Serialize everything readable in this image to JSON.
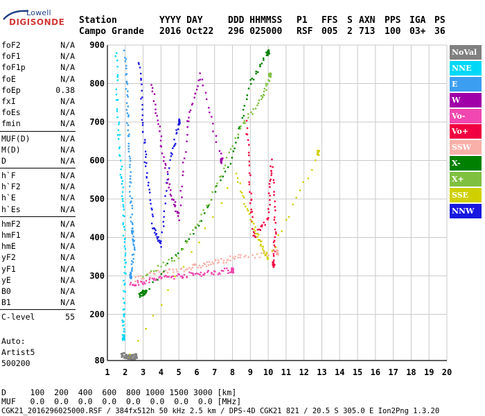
{
  "logo": {
    "top": "Lowell",
    "main": "DIGISONDE"
  },
  "header": {
    "labels": [
      "Station",
      "YYYY DAY",
      "DDD HHMMSS",
      "P1",
      "FFS",
      "S",
      "AXN",
      "PPS",
      "IGA",
      "PS"
    ],
    "values": [
      "Campo Grande",
      "2016 Oct22",
      "296 025000",
      "RSF",
      "005",
      "2",
      "713",
      "100",
      "03+",
      "36"
    ]
  },
  "params": [
    [
      {
        "label": "foF2",
        "value": "N/A"
      },
      {
        "label": "foF1",
        "value": "N/A"
      },
      {
        "label": "foF1p",
        "value": "N/A"
      },
      {
        "label": "foE",
        "value": "N/A"
      },
      {
        "label": "foEp",
        "value": "0.38"
      },
      {
        "label": "fxI",
        "value": "N/A"
      },
      {
        "label": "foEs",
        "value": "N/A"
      },
      {
        "label": "fmin",
        "value": "N/A"
      }
    ],
    [
      {
        "label": "MUF(D)",
        "value": "N/A"
      },
      {
        "label": "M(D)",
        "value": "N/A"
      },
      {
        "label": "D",
        "value": "N/A"
      }
    ],
    [
      {
        "label": "h`F",
        "value": "N/A"
      },
      {
        "label": "h`F2",
        "value": "N/A"
      },
      {
        "label": "h`E",
        "value": "N/A"
      },
      {
        "label": "h`Es",
        "value": "N/A"
      }
    ],
    [
      {
        "label": "hmF2",
        "value": "N/A"
      },
      {
        "label": "hmF1",
        "value": "N/A"
      },
      {
        "label": "hmE",
        "value": "N/A"
      },
      {
        "label": "yF2",
        "value": "N/A"
      },
      {
        "label": "yF1",
        "value": "N/A"
      },
      {
        "label": "yE",
        "value": "N/A"
      },
      {
        "label": "B0",
        "value": "N/A"
      },
      {
        "label": "B1",
        "value": "N/A"
      }
    ],
    [
      {
        "label": "C-level",
        "value": "55"
      }
    ]
  ],
  "auto": {
    "line1": "Auto:",
    "line2": "Artist5",
    "line3": "500200"
  },
  "legend": [
    {
      "label": "NoVal",
      "color": "#808080"
    },
    {
      "label": "NNE",
      "color": "#00d8f8"
    },
    {
      "label": "E",
      "color": "#3c9ef0"
    },
    {
      "label": "W",
      "color": "#a000a8"
    },
    {
      "label": "Vo-",
      "color": "#f048b0"
    },
    {
      "label": "Vo+",
      "color": "#f00040"
    },
    {
      "label": "SSW",
      "color": "#f8b0a8"
    },
    {
      "label": "X-",
      "color": "#008000"
    },
    {
      "label": "X+",
      "color": "#80c040"
    },
    {
      "label": "SSE",
      "color": "#d0d000"
    },
    {
      "label": "NNW",
      "color": "#1818e0"
    }
  ],
  "bottom": {
    "d_row": "D     100  200  400  600  800 1000 1500 3000 [km]",
    "muf_row": "MUF   0.0  0.0  0.0  0.0  0.0  0.0  0.0  0.0 [MHz]",
    "footer": "CGK21_2016296025000.RSF / 384fx512h 50 kHz 2.5 km / DPS-4D CGK21 821 / 20.5 S 305.0 E Ion2Png 1.3.20"
  },
  "chart_data": {
    "type": "scatter",
    "title": "",
    "xlabel": "",
    "ylabel": "",
    "xlim": [
      1,
      20
    ],
    "ylim": [
      80,
      900
    ],
    "x_ticks": [
      1,
      2,
      3,
      4,
      5,
      6,
      7,
      8,
      9,
      10,
      11,
      12,
      13,
      14,
      15,
      16,
      17,
      18,
      19,
      20
    ],
    "y_ticks": [
      80,
      200,
      300,
      400,
      500,
      600,
      700,
      800,
      900
    ],
    "grid": true,
    "legend_position": "right",
    "series": [
      {
        "name": "E",
        "color": "#3c9ef0",
        "points": [
          [
            2.0,
            880
          ],
          [
            2.1,
            760
          ],
          [
            2.2,
            640
          ],
          [
            2.3,
            520
          ],
          [
            2.4,
            420
          ],
          [
            2.5,
            380
          ],
          [
            2.3,
            300
          ]
        ]
      },
      {
        "name": "NNE",
        "color": "#00d8f8",
        "points": [
          [
            1.5,
            880
          ],
          [
            1.6,
            700
          ],
          [
            1.8,
            560
          ],
          [
            1.9,
            440
          ],
          [
            2.0,
            330
          ],
          [
            1.9,
            200
          ],
          [
            1.9,
            140
          ]
        ]
      },
      {
        "name": "NNW",
        "color": "#1818e0",
        "points": [
          [
            2.8,
            860
          ],
          [
            3.0,
            700
          ],
          [
            3.2,
            560
          ],
          [
            3.6,
            420
          ],
          [
            4.0,
            380
          ],
          [
            4.5,
            600
          ],
          [
            5.0,
            700
          ]
        ]
      },
      {
        "name": "W",
        "color": "#a000a8",
        "points": [
          [
            3.5,
            800
          ],
          [
            4.0,
            650
          ],
          [
            4.5,
            520
          ],
          [
            5.0,
            450
          ],
          [
            5.5,
            700
          ],
          [
            6.2,
            820
          ],
          [
            7.4,
            600
          ]
        ]
      },
      {
        "name": "Vo-",
        "color": "#f048b0",
        "points": [
          [
            2.3,
            275
          ],
          [
            3.0,
            285
          ],
          [
            4.0,
            295
          ],
          [
            5.0,
            300
          ],
          [
            6.0,
            305
          ],
          [
            7.0,
            310
          ],
          [
            8.0,
            315
          ]
        ]
      },
      {
        "name": "Vo+",
        "color": "#f00040",
        "points": [
          [
            8.8,
            700
          ],
          [
            9.0,
            520
          ],
          [
            9.2,
            400
          ],
          [
            10.0,
            450
          ],
          [
            10.2,
            600
          ],
          [
            10.4,
            420
          ],
          [
            10.3,
            330
          ]
        ]
      },
      {
        "name": "SSW",
        "color": "#f8b0a8",
        "points": [
          [
            2.5,
            290
          ],
          [
            4.0,
            310
          ],
          [
            5.5,
            320
          ],
          [
            6.5,
            330
          ],
          [
            7.5,
            340
          ],
          [
            8.5,
            350
          ],
          [
            10.5,
            360
          ]
        ]
      },
      {
        "name": "X-",
        "color": "#008000",
        "points": [
          [
            2.8,
            250
          ],
          [
            3.0,
            255
          ],
          [
            3.2,
            260
          ],
          [
            6.0,
            420
          ],
          [
            8.0,
            610
          ],
          [
            9.0,
            800
          ],
          [
            10.0,
            880
          ]
        ]
      },
      {
        "name": "X+",
        "color": "#80c040",
        "points": [
          [
            3.0,
            300
          ],
          [
            5.0,
            350
          ],
          [
            6.8,
            500
          ],
          [
            8.4,
            680
          ],
          [
            9.6,
            760
          ],
          [
            10.1,
            820
          ]
        ]
      },
      {
        "name": "SSE",
        "color": "#d0d000",
        "points": [
          [
            2.2,
            90
          ],
          [
            2.3,
            92
          ],
          [
            8.2,
            560
          ],
          [
            9.1,
            440
          ],
          [
            9.6,
            380
          ],
          [
            10.0,
            340
          ],
          [
            12.8,
            620
          ]
        ]
      },
      {
        "name": "NoVal",
        "color": "#808080",
        "points": [
          [
            1.8,
            95
          ],
          [
            2.0,
            92
          ],
          [
            2.2,
            90
          ],
          [
            2.4,
            88
          ],
          [
            2.6,
            92
          ]
        ]
      }
    ]
  }
}
